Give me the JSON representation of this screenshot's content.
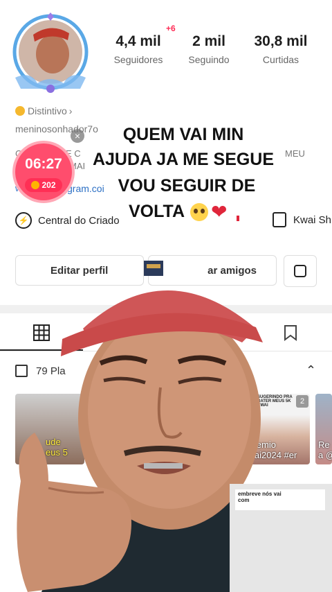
{
  "profile": {
    "notification_badge": "+6",
    "stats": [
      {
        "value": "4,4 mil",
        "label": "Seguidores"
      },
      {
        "value": "2 mil",
        "label": "Seguindo"
      },
      {
        "value": "30,8 mil",
        "label": "Curtidas"
      }
    ],
    "badge_label": "Distintivo",
    "username": "meninosonhador7o",
    "bio_fragment_1": "C",
    "bio_fragment_2": "E C",
    "bio_fragment_3": "MAI",
    "bio_right": "MEU",
    "link_fragment": "w",
    "link_text": "gram.coi",
    "creator_center": "Central do Criado",
    "shop": "Kwai Sh"
  },
  "buttons": {
    "edit_profile": "Editar perfil",
    "find_friends": "ar amigos"
  },
  "timer": {
    "time": "06:27",
    "coins": "202"
  },
  "overlay_caption": {
    "line1": "QUEM VAI MIN",
    "line2": "AJUDA JA ME SEGUE",
    "line3": "VOU SEGUIR DE",
    "line4": "VOLTA"
  },
  "videos": {
    "playlist_label": "79 Pla",
    "thumbs": [
      {
        "text": "ude\neus 5"
      },
      {
        "text": "#premio\nkwai2024 #er"
      },
      {
        "text": "Re\na @"
      }
    ],
    "thumb_count": "2",
    "thumb_header": "SUGERINDO PRA\nBATER MEUS 5K\nKWAI",
    "bottom_caption": "embreve nós vai\ncom"
  },
  "colors": {
    "accent": "#fe2c55",
    "timer_bg": "#ff4d6d",
    "coin": "#ffb300",
    "cap": "#c94a4a"
  }
}
